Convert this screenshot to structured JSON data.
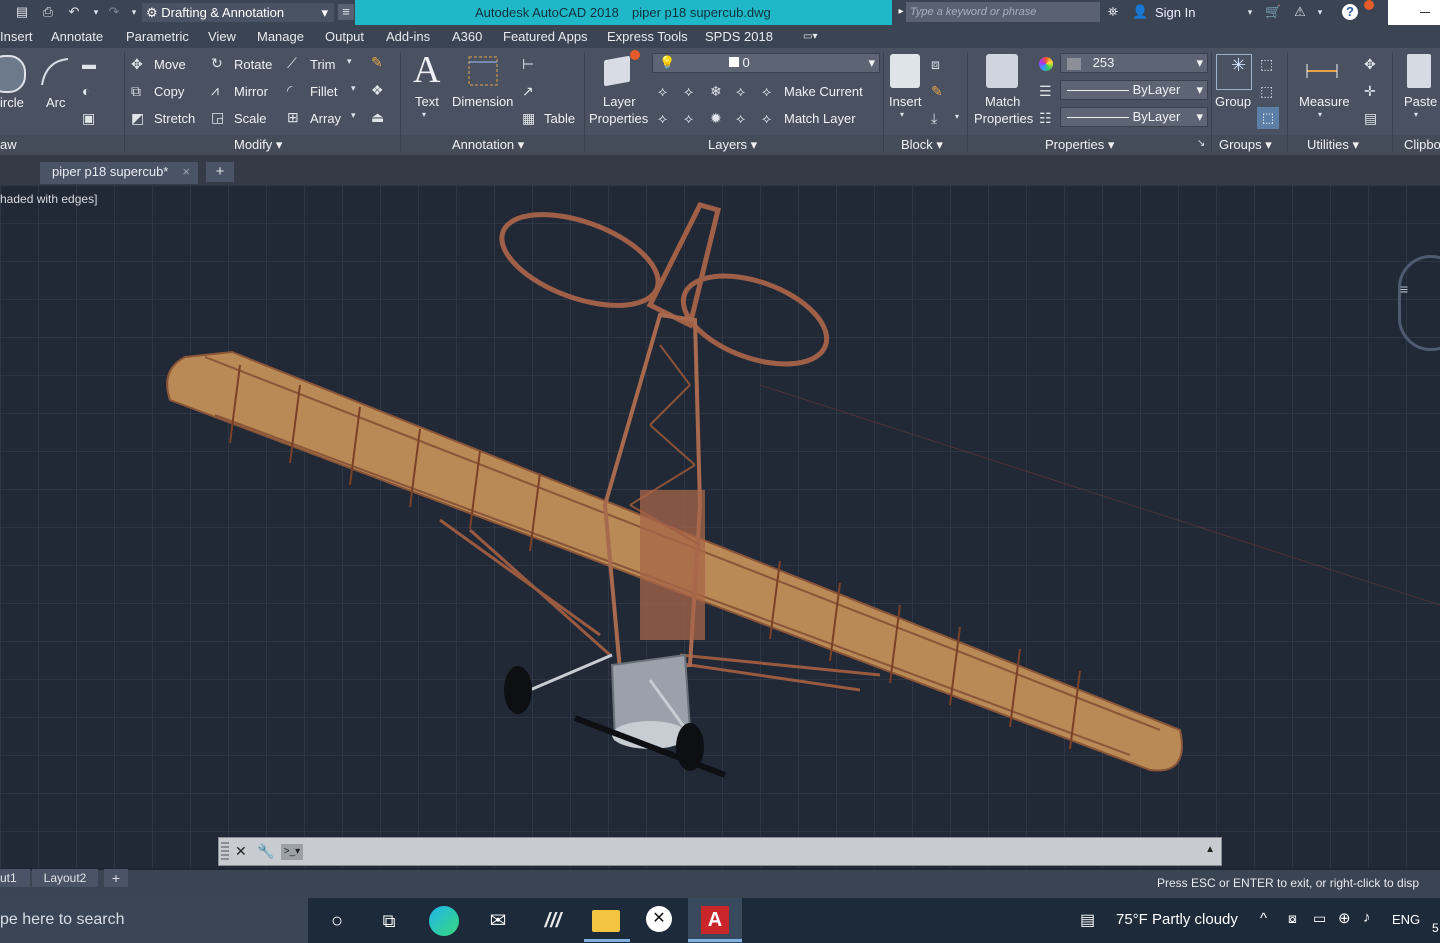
{
  "titlebar": {
    "workspace": "Drafting & Annotation",
    "app_title": "Autodesk AutoCAD 2018",
    "file_title": "piper p18 supercub.dwg",
    "search_placeholder": "Type a keyword or phrase",
    "sign_in": "Sign In"
  },
  "menu": [
    "Insert",
    "Annotate",
    "Parametric",
    "View",
    "Manage",
    "Output",
    "Add-ins",
    "A360",
    "Featured Apps",
    "Express Tools",
    "SPDS 2018"
  ],
  "ribbon": {
    "draw": {
      "circle": "ircle",
      "arc": "Arc",
      "panel": "aw"
    },
    "modify": {
      "move": "Move",
      "rotate": "Rotate",
      "trim": "Trim",
      "copy": "Copy",
      "mirror": "Mirror",
      "fillet": "Fillet",
      "stretch": "Stretch",
      "scale": "Scale",
      "array": "Array",
      "panel": "Modify"
    },
    "annotation": {
      "text": "Text",
      "dimension": "Dimension",
      "table": "Table",
      "panel": "Annotation"
    },
    "layers": {
      "layer_properties_1": "Layer",
      "layer_properties_2": "Properties",
      "layer_value": "0",
      "make_current": "Make Current",
      "match_layer": "Match Layer",
      "panel": "Layers"
    },
    "block": {
      "insert": "Insert",
      "panel": "Block"
    },
    "properties": {
      "match_1": "Match",
      "match_2": "Properties",
      "color_value": "253",
      "linetype": "ByLayer",
      "lineweight": "ByLayer",
      "panel": "Properties"
    },
    "groups": {
      "group": "Group",
      "panel": "Groups"
    },
    "utilities": {
      "measure": "Measure",
      "panel": "Utilities"
    },
    "clipboard": {
      "paste": "Paste",
      "panel": "Clipbo"
    }
  },
  "filetab": {
    "name": "piper p18 supercub*"
  },
  "viewport": {
    "label": "haded with edges]"
  },
  "layout_tabs": [
    "ut1",
    "Layout2"
  ],
  "status": {
    "message": "Press ESC or ENTER to exit, or right-click to disp"
  },
  "taskbar": {
    "search_text": "pe here to search",
    "weather": "75°F  Partly cloudy",
    "lang": "ENG",
    "clock_fragment": "5"
  },
  "colors": {
    "title_accent": "#1fb8c9",
    "ribbon_bg": "#4a5261",
    "viewport_bg": "#212836",
    "airframe": "#b06a4c",
    "wing_skin": "#b98a55",
    "autocad_red": "#c8262b"
  }
}
